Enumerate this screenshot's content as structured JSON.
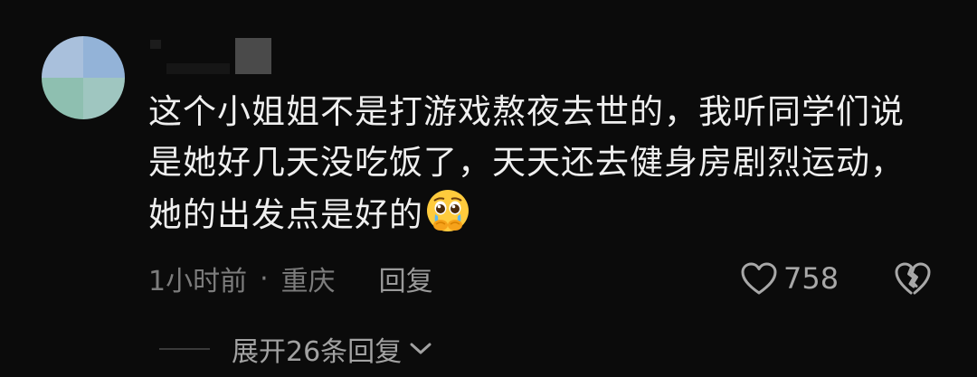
{
  "comment": {
    "text_line1": "这个小姐姐不是打游戏熬夜去世的，我听同学们说",
    "text_line2": "是她好几天没吃饭了，天天还去健身房剧烈运动，",
    "text_line3": "她的出发点是好的",
    "emoji": "pleading-face-crying-emoji",
    "time": "1小时前",
    "separator": "·",
    "location": "重庆",
    "reply_label": "回复",
    "like_count": "758",
    "expand_label": "展开26条回复"
  },
  "icons": {
    "like": "heart-outline-icon",
    "dislike": "broken-heart-icon",
    "expand": "chevron-down-icon"
  },
  "colors": {
    "background": "#0b0b0b",
    "text": "#efefef",
    "meta": "#7c7c7c"
  }
}
